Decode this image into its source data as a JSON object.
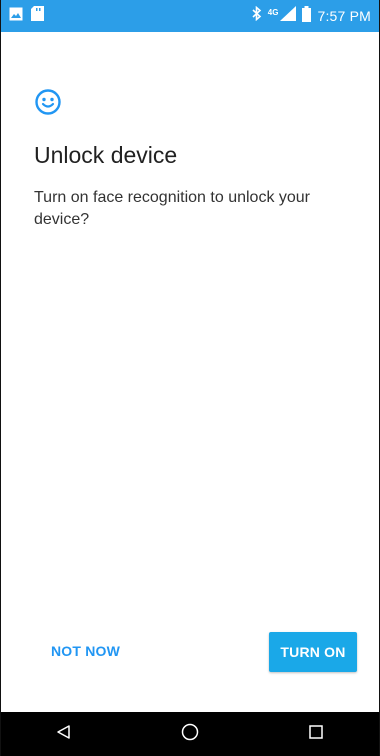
{
  "status_bar": {
    "time": "7:57 PM",
    "network": "4G"
  },
  "icons": {
    "face": "smiley-face-icon",
    "image": "image-icon",
    "sd_card": "sd-card-icon",
    "bluetooth": "bluetooth-icon",
    "signal": "signal-icon",
    "battery": "battery-icon",
    "back": "back-icon",
    "home": "home-icon",
    "recents": "recents-icon"
  },
  "dialog": {
    "title": "Unlock device",
    "description": "Turn on face recognition to unlock your device?"
  },
  "actions": {
    "not_now_label": "NOT NOW",
    "turn_on_label": "TURN ON"
  },
  "colors": {
    "status_bar": "#2c9ee8",
    "accent": "#2196f3",
    "button": "#1aa8e8"
  }
}
